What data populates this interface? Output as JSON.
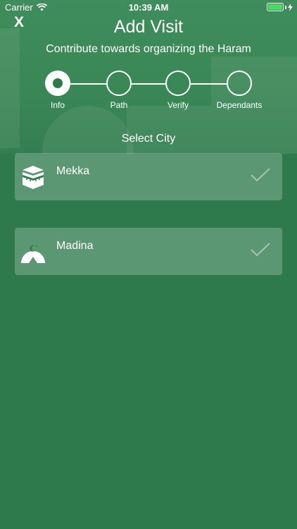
{
  "status_bar": {
    "carrier": "Carrier",
    "time": "10:39 AM",
    "wifi_icon": "wifi-icon",
    "battery_icon": "battery-icon",
    "charging_icon": "bolt-icon",
    "battery_level": 1.0,
    "battery_color": "#4cd964"
  },
  "header": {
    "close_label": "X",
    "title": "Add Visit",
    "subtitle": "Contribute towards organizing the Haram"
  },
  "stepper": {
    "steps": [
      {
        "label": "Info",
        "active": true
      },
      {
        "label": "Path",
        "active": false
      },
      {
        "label": "Verify",
        "active": false
      },
      {
        "label": "Dependants",
        "active": false
      }
    ]
  },
  "city_select": {
    "title": "Select City",
    "cities": [
      {
        "name": "Mekka",
        "icon": "kaaba-icon",
        "check_icon": "checkmark-icon"
      },
      {
        "name": "Madina",
        "icon": "mosque-dome-icon",
        "check_icon": "checkmark-icon"
      }
    ]
  },
  "colors": {
    "background": "#2e7a4c",
    "header_tint": "#3f8d5c",
    "card": "rgba(255,255,255,0.22)",
    "text": "#ffffff"
  }
}
